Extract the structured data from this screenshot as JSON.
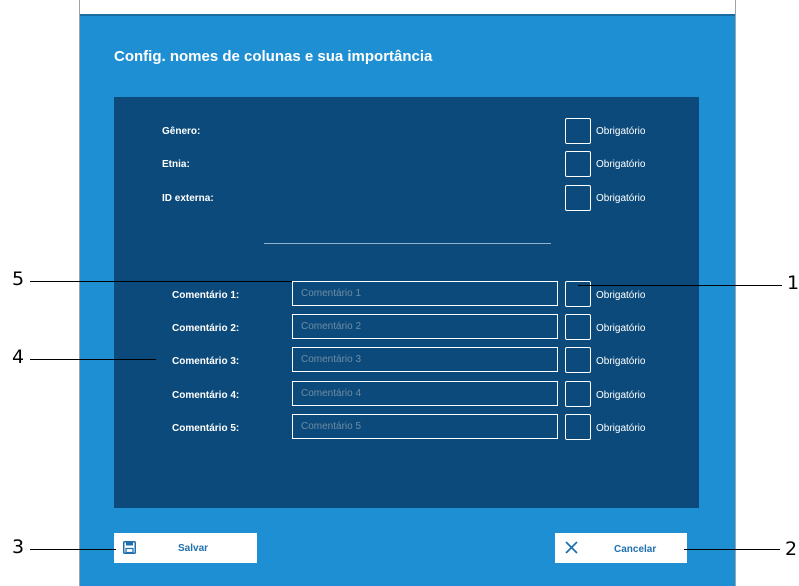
{
  "dialog": {
    "title": "Config. nomes de colunas e sua importância"
  },
  "fields": [
    {
      "label": "Gênero:"
    },
    {
      "label": "Etnia:"
    },
    {
      "label": "ID externa:"
    }
  ],
  "required_label": "Obrigatório",
  "comments": [
    {
      "label": "Comentário 1:",
      "placeholder": "Comentário 1",
      "value": ""
    },
    {
      "label": "Comentário 2:",
      "placeholder": "Comentário 2",
      "value": ""
    },
    {
      "label": "Comentário 3:",
      "placeholder": "Comentário 3",
      "value": ""
    },
    {
      "label": "Comentário 4:",
      "placeholder": "Comentário 4",
      "value": ""
    },
    {
      "label": "Comentário 5:",
      "placeholder": "Comentário 5",
      "value": ""
    }
  ],
  "buttons": {
    "save_label": "Salvar",
    "cancel_label": "Cancelar",
    "save_icon": "floppy-disk-icon",
    "cancel_icon": "close-x-icon"
  },
  "callouts": {
    "c1": "1",
    "c2": "2",
    "c3": "3",
    "c4": "4",
    "c5": "5"
  },
  "colors": {
    "dialog_bg": "#1f8fd4",
    "panel_bg": "#0b4a7a",
    "button_text": "#1f6fb0"
  }
}
